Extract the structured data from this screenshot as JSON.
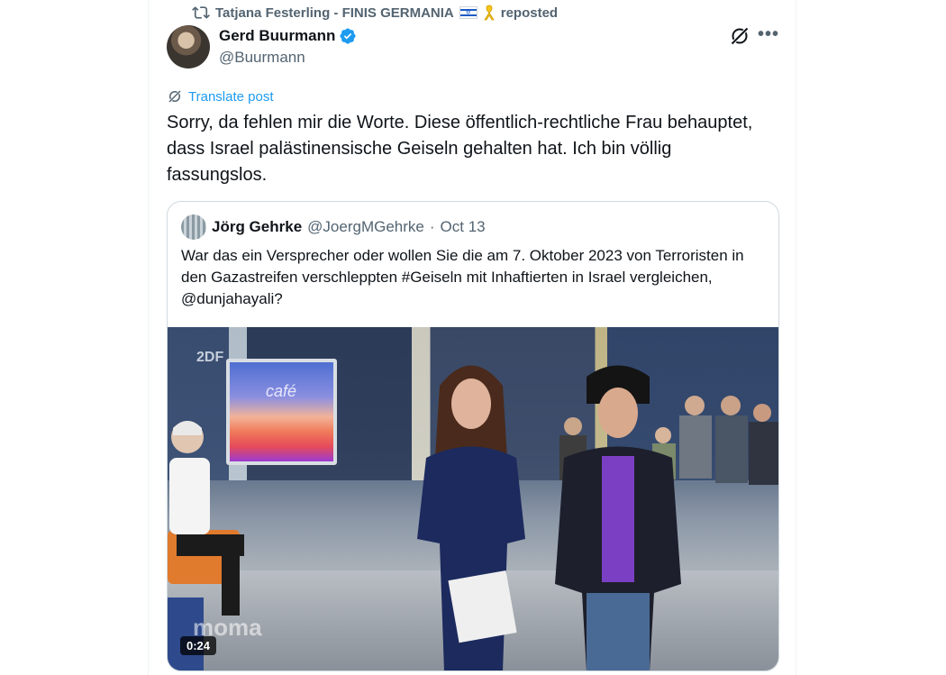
{
  "repost": {
    "user": "Tatjana Festerling - FINIS GERMANIA",
    "label": "reposted"
  },
  "post": {
    "author_name": "Gerd Buurmann",
    "handle": "@Buurmann",
    "translate_label": "Translate post",
    "text": "Sorry, da fehlen mir die Worte. Diese öffentlich-rechtliche Frau behauptet, dass Israel palästinensische Geiseln gehalten hat. Ich bin völlig fassungslos."
  },
  "quote": {
    "author_name": "Jörg Gehrke",
    "handle": "@JoergMGehrke",
    "separator": "·",
    "date": "Oct 13",
    "text": "War das ein Versprecher oder wollen Sie die am 7. Oktober 2023 von Terroristen in den Gazastreifen verschleppten #Geiseln mit Inhaftierten in Israel vergleichen, @dunjahayali?",
    "video": {
      "duration": "0:24",
      "screen_text": "café",
      "channel_logo": "2DF",
      "watermark": "moma"
    }
  },
  "colors": {
    "accent": "#1d9bf0",
    "secondary_text": "#536471",
    "border": "#cfd9de"
  },
  "icons": [
    "repost-icon",
    "flag-israel-icon",
    "yellow-ribbon-icon",
    "verified-badge-icon",
    "grok-icon",
    "more-icon",
    "translate-icon"
  ]
}
